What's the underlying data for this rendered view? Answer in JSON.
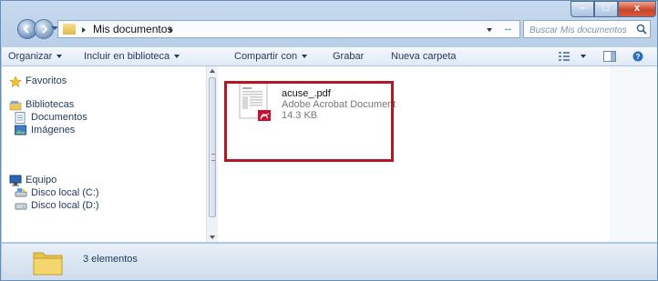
{
  "address": {
    "crumb": "Mis documentos",
    "search_placeholder": "Buscar Mis documentos"
  },
  "toolbar": {
    "organize": "Organizar",
    "include": "Incluir en biblioteca",
    "share": "Compartir con",
    "burn": "Grabar",
    "new_folder": "Nueva carpeta"
  },
  "nav": {
    "favorites": "Favoritos",
    "libraries": "Bibliotecas",
    "documents": "Documentos",
    "images": "Imágenes",
    "computer": "Equipo",
    "disk_c": "Disco local (C:)",
    "disk_d": "Disco local (D:)"
  },
  "file": {
    "name": "acuse_.pdf",
    "type": "Adobe Acrobat Document",
    "size": "14.3 KB"
  },
  "status": {
    "count": "3 elementos"
  },
  "colors": {
    "highlight_border": "#b01825",
    "pdf_red": "#c8102e"
  }
}
